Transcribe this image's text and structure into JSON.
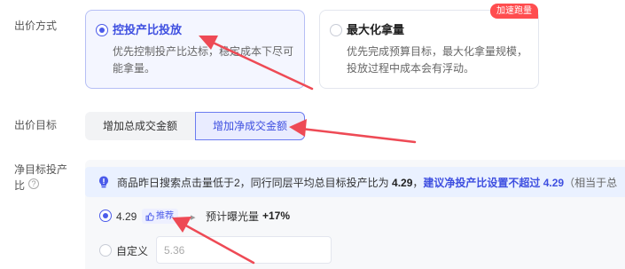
{
  "bid_method": {
    "label": "出价方式",
    "options": [
      {
        "title": "控投产比投放",
        "desc_lines": [
          "优先控制投产比达标，稳定成本下尽可",
          "能拿量。"
        ],
        "selected": true
      },
      {
        "title": "最大化拿量",
        "desc_lines": [
          "优先完成预算目标，最大化拿量规模，",
          "投放过程中成本会有浮动。"
        ],
        "selected": false,
        "badge": "加速跑量"
      }
    ]
  },
  "bid_target": {
    "label": "出价目标",
    "segments": [
      {
        "label": "增加总成交金额",
        "active": false
      },
      {
        "label": "增加净成交金额",
        "active": true
      }
    ]
  },
  "net_roi": {
    "label_line1": "净目标投产",
    "label_line2": "比",
    "help": "?",
    "tip": {
      "part1": "商品昨日搜索点击量低于2，同行同层平均总目标投产比为",
      "value": "4.29",
      "part2": "，",
      "suggest": "建议净投产比设置不超过 4.29",
      "tail": "（相当于总"
    },
    "option_recommended": {
      "value": "4.29",
      "tag": "推荐",
      "exposure_label": "预计曝光量",
      "exposure_value": "+17%"
    },
    "option_custom": {
      "label": "自定义",
      "placeholder": "5.36"
    }
  },
  "colors": {
    "accent": "#4b5bea",
    "arrow": "#ee4a55",
    "badge": "#ff4d4f"
  }
}
